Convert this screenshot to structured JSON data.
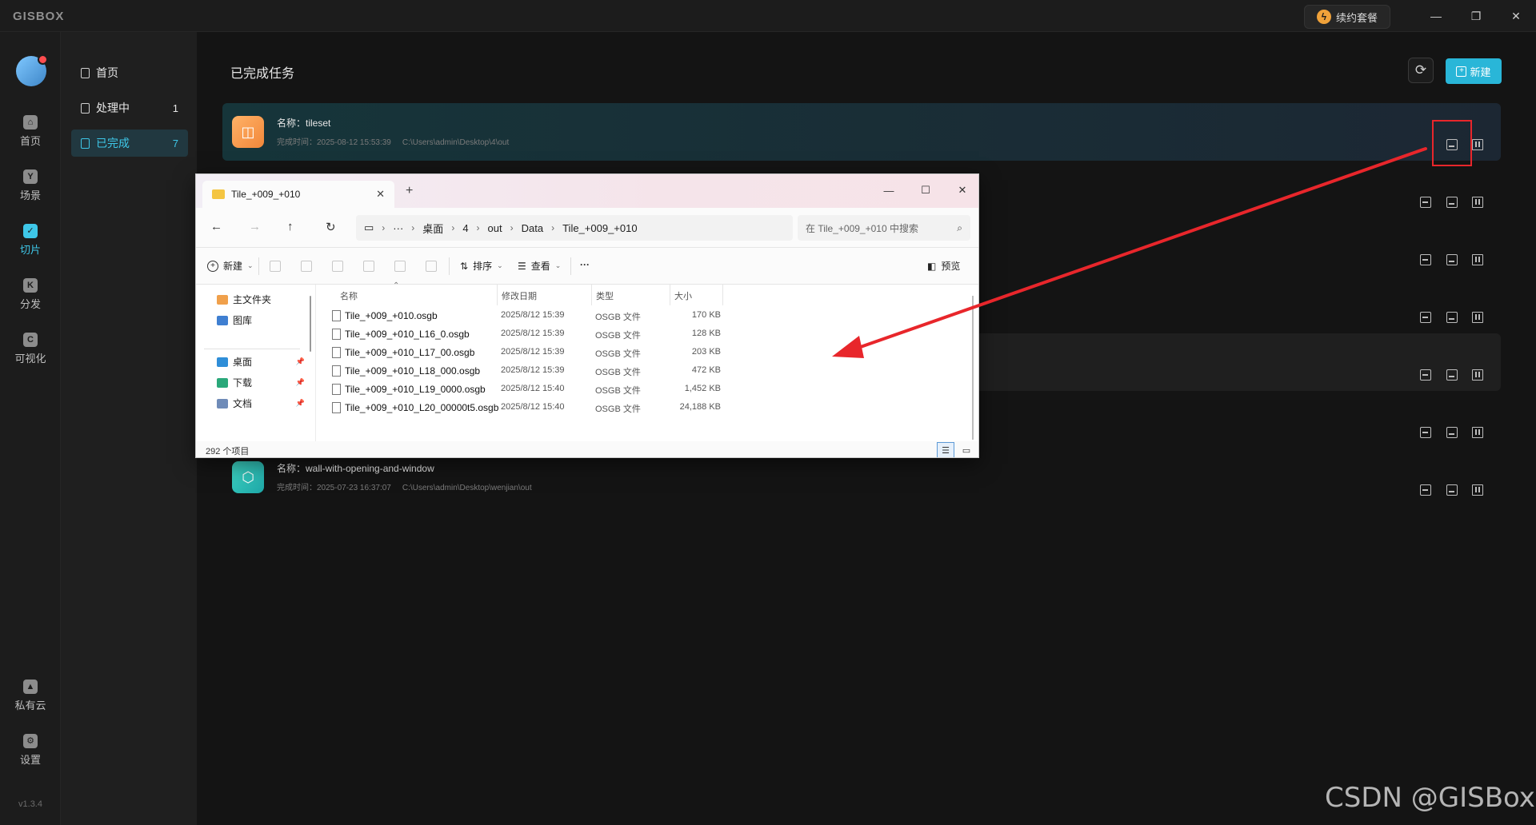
{
  "titlebar": {
    "app_name": "GISBOX",
    "renew_label": "续约套餐",
    "minimize": "—",
    "restore": "❐",
    "close": "✕"
  },
  "rail": {
    "items": [
      {
        "label": "首页",
        "icon": "home-icon",
        "glyph": "⌂"
      },
      {
        "label": "场景",
        "icon": "scene-icon",
        "glyph": "Y"
      },
      {
        "label": "切片",
        "icon": "slice-icon",
        "glyph": "✓"
      },
      {
        "label": "分发",
        "icon": "distribute-icon",
        "glyph": "K"
      },
      {
        "label": "可视化",
        "icon": "visualize-icon",
        "glyph": "C"
      }
    ],
    "bottom": [
      {
        "label": "私有云",
        "icon": "lock-icon",
        "glyph": "▲"
      },
      {
        "label": "设置",
        "icon": "settings-icon",
        "glyph": "⚙"
      }
    ],
    "version": "v1.3.4"
  },
  "subnav": {
    "items": [
      {
        "label": "首页",
        "count": ""
      },
      {
        "label": "处理中",
        "count": "1"
      },
      {
        "label": "已完成",
        "count": "7"
      }
    ]
  },
  "main": {
    "title": "已完成任务",
    "new_label": "新建",
    "tasks": [
      {
        "name": "名称：tileset",
        "time": "完成时间：2025-08-12 15:53:39",
        "path": "C:\\Users\\admin\\Desktop\\4\\out"
      },
      {
        "name": "名称：wall-with-opening-and-window",
        "time": "完成时间：2025-07-23 16:37:07",
        "path": "C:\\Users\\admin\\Desktop\\wenjian\\out"
      }
    ]
  },
  "explorer": {
    "tab_title": "Tile_+009_+010",
    "new_tab": "+",
    "breadcrumb": [
      "···",
      "桌面",
      "4",
      "out",
      "Data",
      "Tile_+009_+010"
    ],
    "search_placeholder": "在 Tile_+009_+010 中搜索",
    "toolbar": {
      "new": "新建",
      "sort": "排序",
      "view": "查看",
      "more": "···",
      "preview": "预览"
    },
    "tree": {
      "home": "主文件夹",
      "gallery": "图库",
      "desktop": "桌面",
      "downloads": "下载",
      "documents": "文档"
    },
    "columns": {
      "name": "名称",
      "date": "修改日期",
      "type": "类型",
      "size": "大小"
    },
    "files": [
      {
        "name": "Tile_+009_+010.osgb",
        "date": "2025/8/12 15:39",
        "type": "OSGB 文件",
        "size": "170 KB"
      },
      {
        "name": "Tile_+009_+010_L16_0.osgb",
        "date": "2025/8/12 15:39",
        "type": "OSGB 文件",
        "size": "128 KB"
      },
      {
        "name": "Tile_+009_+010_L17_00.osgb",
        "date": "2025/8/12 15:39",
        "type": "OSGB 文件",
        "size": "203 KB"
      },
      {
        "name": "Tile_+009_+010_L18_000.osgb",
        "date": "2025/8/12 15:39",
        "type": "OSGB 文件",
        "size": "472 KB"
      },
      {
        "name": "Tile_+009_+010_L19_0000.osgb",
        "date": "2025/8/12 15:40",
        "type": "OSGB 文件",
        "size": "1,452 KB"
      },
      {
        "name": "Tile_+009_+010_L20_00000t5.osgb",
        "date": "2025/8/12 15:40",
        "type": "OSGB 文件",
        "size": "24,188 KB"
      }
    ],
    "status_count": "292 个项目"
  },
  "watermark": "CSDN @GISBox",
  "colors": {
    "accent": "#3ec7e8",
    "primary_button": "#29b6d8",
    "annotation_red": "#e8262b"
  }
}
